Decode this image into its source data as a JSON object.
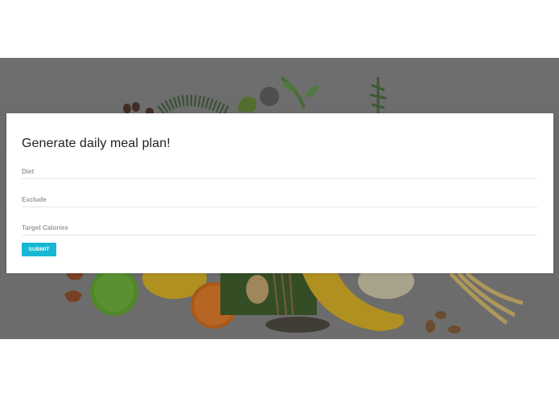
{
  "form": {
    "title": "Generate daily meal plan!",
    "fields": [
      {
        "value": "",
        "placeholder": "Diet"
      },
      {
        "value": "",
        "placeholder": "Exclude"
      },
      {
        "value": "",
        "placeholder": "Target Calories"
      }
    ],
    "submit_label": "SUBMIT"
  },
  "colors": {
    "accent": "#17b7d3",
    "overlay": "#6d6d6d",
    "card": "#ffffff"
  }
}
